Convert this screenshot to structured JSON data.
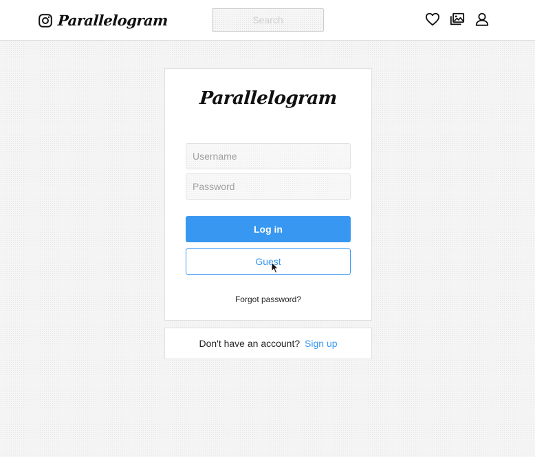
{
  "header": {
    "brand_name": "Parallelogram",
    "search_placeholder": "Search",
    "icons": [
      "instagram-icon",
      "heart-icon",
      "gallery-icon",
      "user-icon"
    ]
  },
  "login_card": {
    "logo_text": "Parallelogram",
    "username_placeholder": "Username",
    "password_placeholder": "Password",
    "login_label": "Log in",
    "guest_label": "Guest",
    "forgot_label": "Forgot password?"
  },
  "signup_card": {
    "prompt": "Don't have an account?",
    "link_label": "Sign up"
  },
  "colors": {
    "accent": "#3897f0",
    "text": "#262626",
    "border": "#e1e1e1"
  }
}
